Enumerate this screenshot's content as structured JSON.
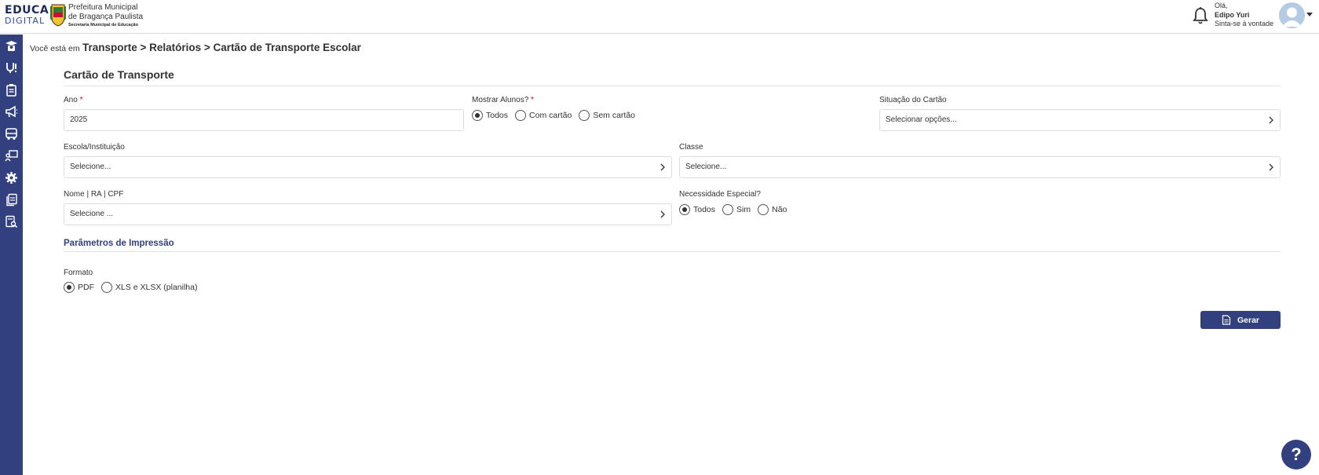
{
  "header": {
    "logo_line1": "EDUCA",
    "logo_line2": "DIGITAL",
    "pref_line1": "Prefeitura Municipal",
    "pref_line2": "de Bragança Paulista",
    "pref_line3": "Secretaria Municipal de Educação",
    "user": {
      "greeting": "Olá,",
      "name": "Edipo Yuri",
      "subtitle": "Sinta-se à vontade"
    }
  },
  "sidebar": {
    "icons": [
      "graduation-icon",
      "medical-icon",
      "clipboard-icon",
      "megaphone-icon",
      "bus-icon",
      "teacher-icon",
      "gear-icon",
      "documents-icon",
      "report-search-icon"
    ]
  },
  "breadcrumb": {
    "prefix": "Você está em",
    "path": "Transporte > Relatórios > Cartão de Transporte Escolar"
  },
  "form": {
    "title": "Cartão de Transporte",
    "ano": {
      "label": "Ano",
      "required": "*",
      "value": "2025"
    },
    "mostrar_alunos": {
      "label": "Mostrar Alunos?",
      "required": "*",
      "options": [
        "Todos",
        "Com cartão",
        "Sem cartão"
      ],
      "selected": "Todos"
    },
    "situacao_cartao": {
      "label": "Situação do Cartão",
      "placeholder": "Selecionar opções..."
    },
    "escola": {
      "label": "Escola/Instituição",
      "placeholder": "Selecione..."
    },
    "classe": {
      "label": "Classe",
      "placeholder": "Selecione..."
    },
    "nome": {
      "label": "Nome | RA | CPF",
      "placeholder": "Selecione ..."
    },
    "necessidade": {
      "label": "Necessidade Especial?",
      "options": [
        "Todos",
        "Sim",
        "Não"
      ],
      "selected": "Todos"
    },
    "print_params_title": "Parâmetros de Impressão",
    "formato": {
      "label": "Formato",
      "options": [
        "PDF",
        "XLS e XLSX (planilha)"
      ],
      "selected": "PDF"
    },
    "submit_label": "Gerar"
  },
  "help_label": "?",
  "colors": {
    "primary": "#33407f",
    "required": "#d9001b"
  }
}
